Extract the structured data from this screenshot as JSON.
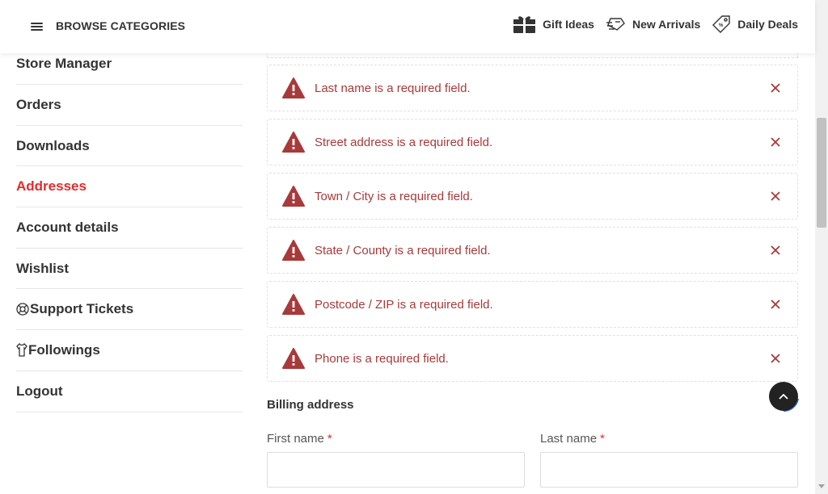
{
  "header": {
    "browse_label": "BROWSE CATEGORIES",
    "links": [
      {
        "label": "Gift Ideas",
        "icon": "gift-icon"
      },
      {
        "label": "New Arrivals",
        "icon": "new-arrivals-icon"
      },
      {
        "label": "Daily Deals",
        "icon": "price-tag-icon"
      }
    ]
  },
  "sidebar": {
    "items": [
      {
        "label": "Store Manager"
      },
      {
        "label": "Orders"
      },
      {
        "label": "Downloads"
      },
      {
        "label": "Addresses",
        "active": true
      },
      {
        "label": "Account details"
      },
      {
        "label": "Wishlist"
      },
      {
        "label": "Support Tickets",
        "icon": "lifebuoy-icon"
      },
      {
        "label": "Followings",
        "icon": "shirt-icon"
      },
      {
        "label": "Logout"
      }
    ]
  },
  "errors": [
    {
      "message": "Last name is a required field."
    },
    {
      "message": "Street address is a required field."
    },
    {
      "message": "Town / City is a required field."
    },
    {
      "message": "State / County is a required field."
    },
    {
      "message": "Postcode / ZIP is a required field."
    },
    {
      "message": "Phone is a required field."
    }
  ],
  "billing": {
    "title": "Billing address",
    "first_name_label": "First name",
    "last_name_label": "Last name",
    "required_mark": "*",
    "first_name_value": "",
    "last_name_value": ""
  },
  "colors": {
    "accent": "#e42b2b",
    "error_text": "#a73a3a",
    "error_icon": "#a73a3a"
  }
}
